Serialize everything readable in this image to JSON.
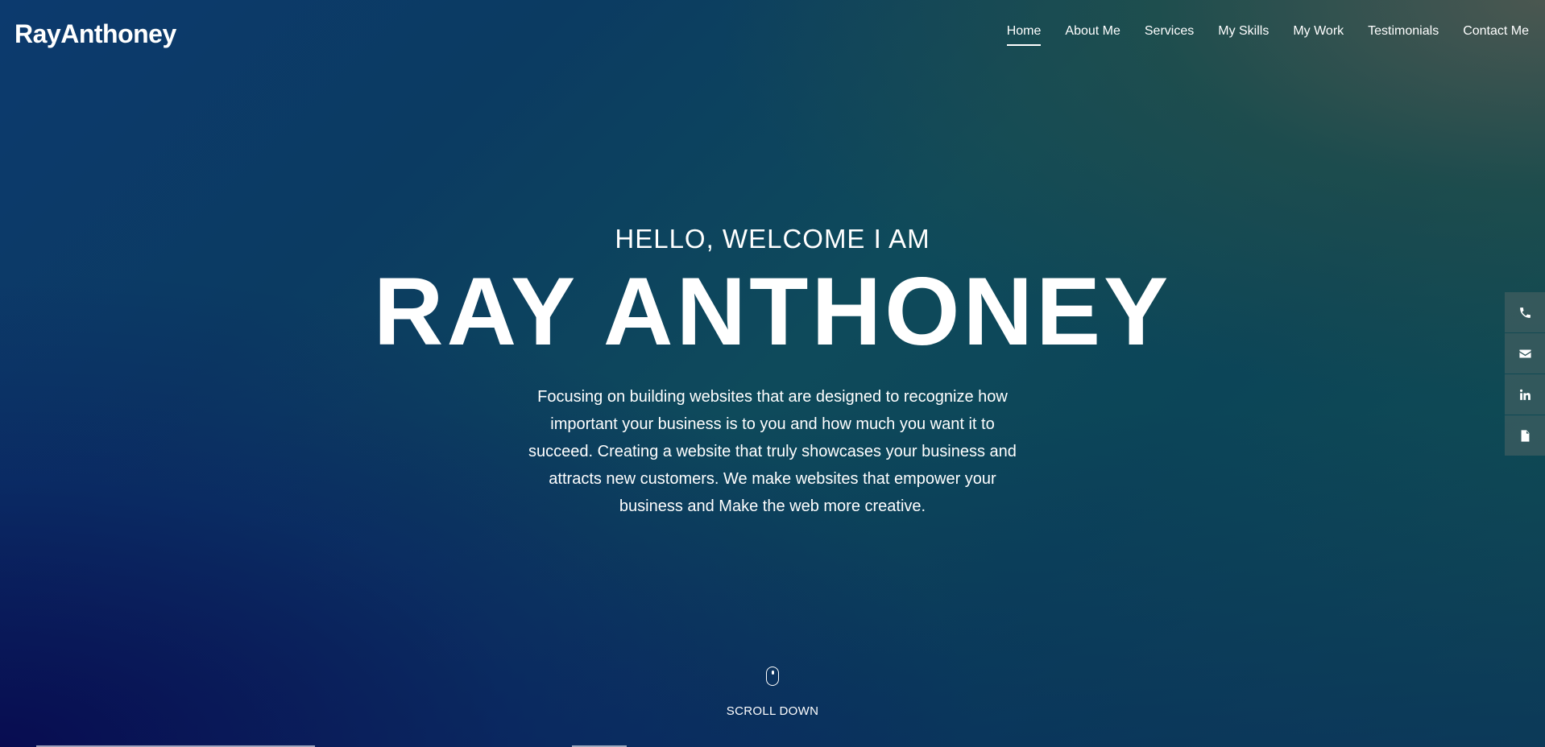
{
  "brand": "RayAnthoney",
  "nav": [
    {
      "label": "Home",
      "active": true
    },
    {
      "label": "About Me"
    },
    {
      "label": "Services"
    },
    {
      "label": "My Skills"
    },
    {
      "label": "My Work"
    },
    {
      "label": "Testimonials"
    },
    {
      "label": "Contact Me"
    }
  ],
  "hero": {
    "greeting": "HELLO, WELCOME I AM",
    "name": "RAY ANTHONEY",
    "intro": "Focusing on building websites that are designed to recognize how important your business is to you and how much you want it to succeed. Creating a website that truly showcases your business and attracts new customers. We make websites that empower your business and Make the web more creative."
  },
  "scroll": {
    "label": "SCROLL DOWN",
    "icon": "mouse-icon"
  },
  "social": [
    {
      "icon": "phone-icon"
    },
    {
      "icon": "envelope-icon"
    },
    {
      "icon": "linkedin-icon"
    },
    {
      "icon": "document-icon"
    }
  ],
  "colors": {
    "text": "#ffffff",
    "bg_top": "#0c3a6e",
    "bg_mid": "#0e4a5b",
    "bg_corner": "#4e5850"
  }
}
